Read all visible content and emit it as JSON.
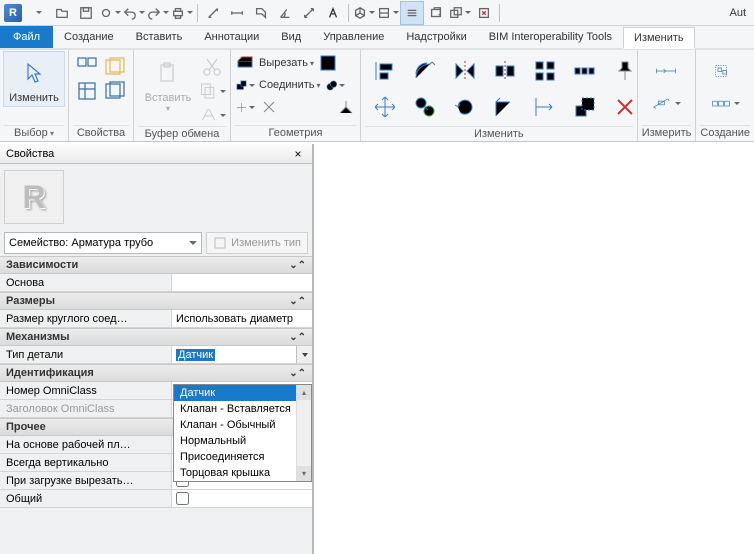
{
  "qat_right": "Aut",
  "tabs": {
    "file": "Файл",
    "items": [
      "Создание",
      "Вставить",
      "Аннотации",
      "Вид",
      "Управление",
      "Надстройки",
      "BIM Interoperability Tools",
      "Изменить"
    ],
    "active": "Изменить"
  },
  "ribbon": {
    "select": {
      "big": "Изменить",
      "label": "Выбор"
    },
    "properties": {
      "label": "Свойства"
    },
    "clipboard": {
      "big": "Вставить",
      "label": "Буфер обмена"
    },
    "geometry": {
      "label": "Геометрия",
      "cut": "Вырезать",
      "join": "Соединить"
    },
    "modify": {
      "label": "Изменить"
    },
    "measure": {
      "label": "Измерить"
    },
    "create": {
      "label": "Создание"
    }
  },
  "props": {
    "title": "Свойства",
    "family_selector": "Семейство: Арматура трубо",
    "edit_type": "Изменить тип",
    "groups": {
      "deps": {
        "head": "Зависимости",
        "rows": [
          {
            "l": "Основа",
            "r": ""
          }
        ]
      },
      "size": {
        "head": "Размеры",
        "rows": [
          {
            "l": "Размер круглого соед…",
            "r": "Использовать диаметр"
          }
        ]
      },
      "mech": {
        "head": "Механизмы",
        "rows": [
          {
            "l": "Тип детали",
            "r": "Датчик",
            "dropdown": true
          }
        ]
      },
      "ident": {
        "head": "Идентификация",
        "rows": [
          {
            "l": "Номер OmniClass",
            "r": ""
          },
          {
            "l": "Заголовок OmniClass",
            "r": "",
            "dim": true
          }
        ]
      },
      "other": {
        "head": "Прочее",
        "rows": [
          {
            "l": "На основе рабочей пл…",
            "cb": true,
            "checked": false
          },
          {
            "l": "Всегда вертикально",
            "cb": true,
            "checked": false
          },
          {
            "l": "При загрузке вырезать…",
            "cb": true,
            "checked": false
          },
          {
            "l": "Общий",
            "cb": true,
            "checked": false
          }
        ]
      }
    },
    "dropdown_options": [
      "Датчик",
      "Клапан - Вставляется",
      "Клапан - Обычный",
      "Нормальный",
      "Присоединяется",
      "Торцовая крышка"
    ],
    "dropdown_highlight": "Датчик"
  }
}
